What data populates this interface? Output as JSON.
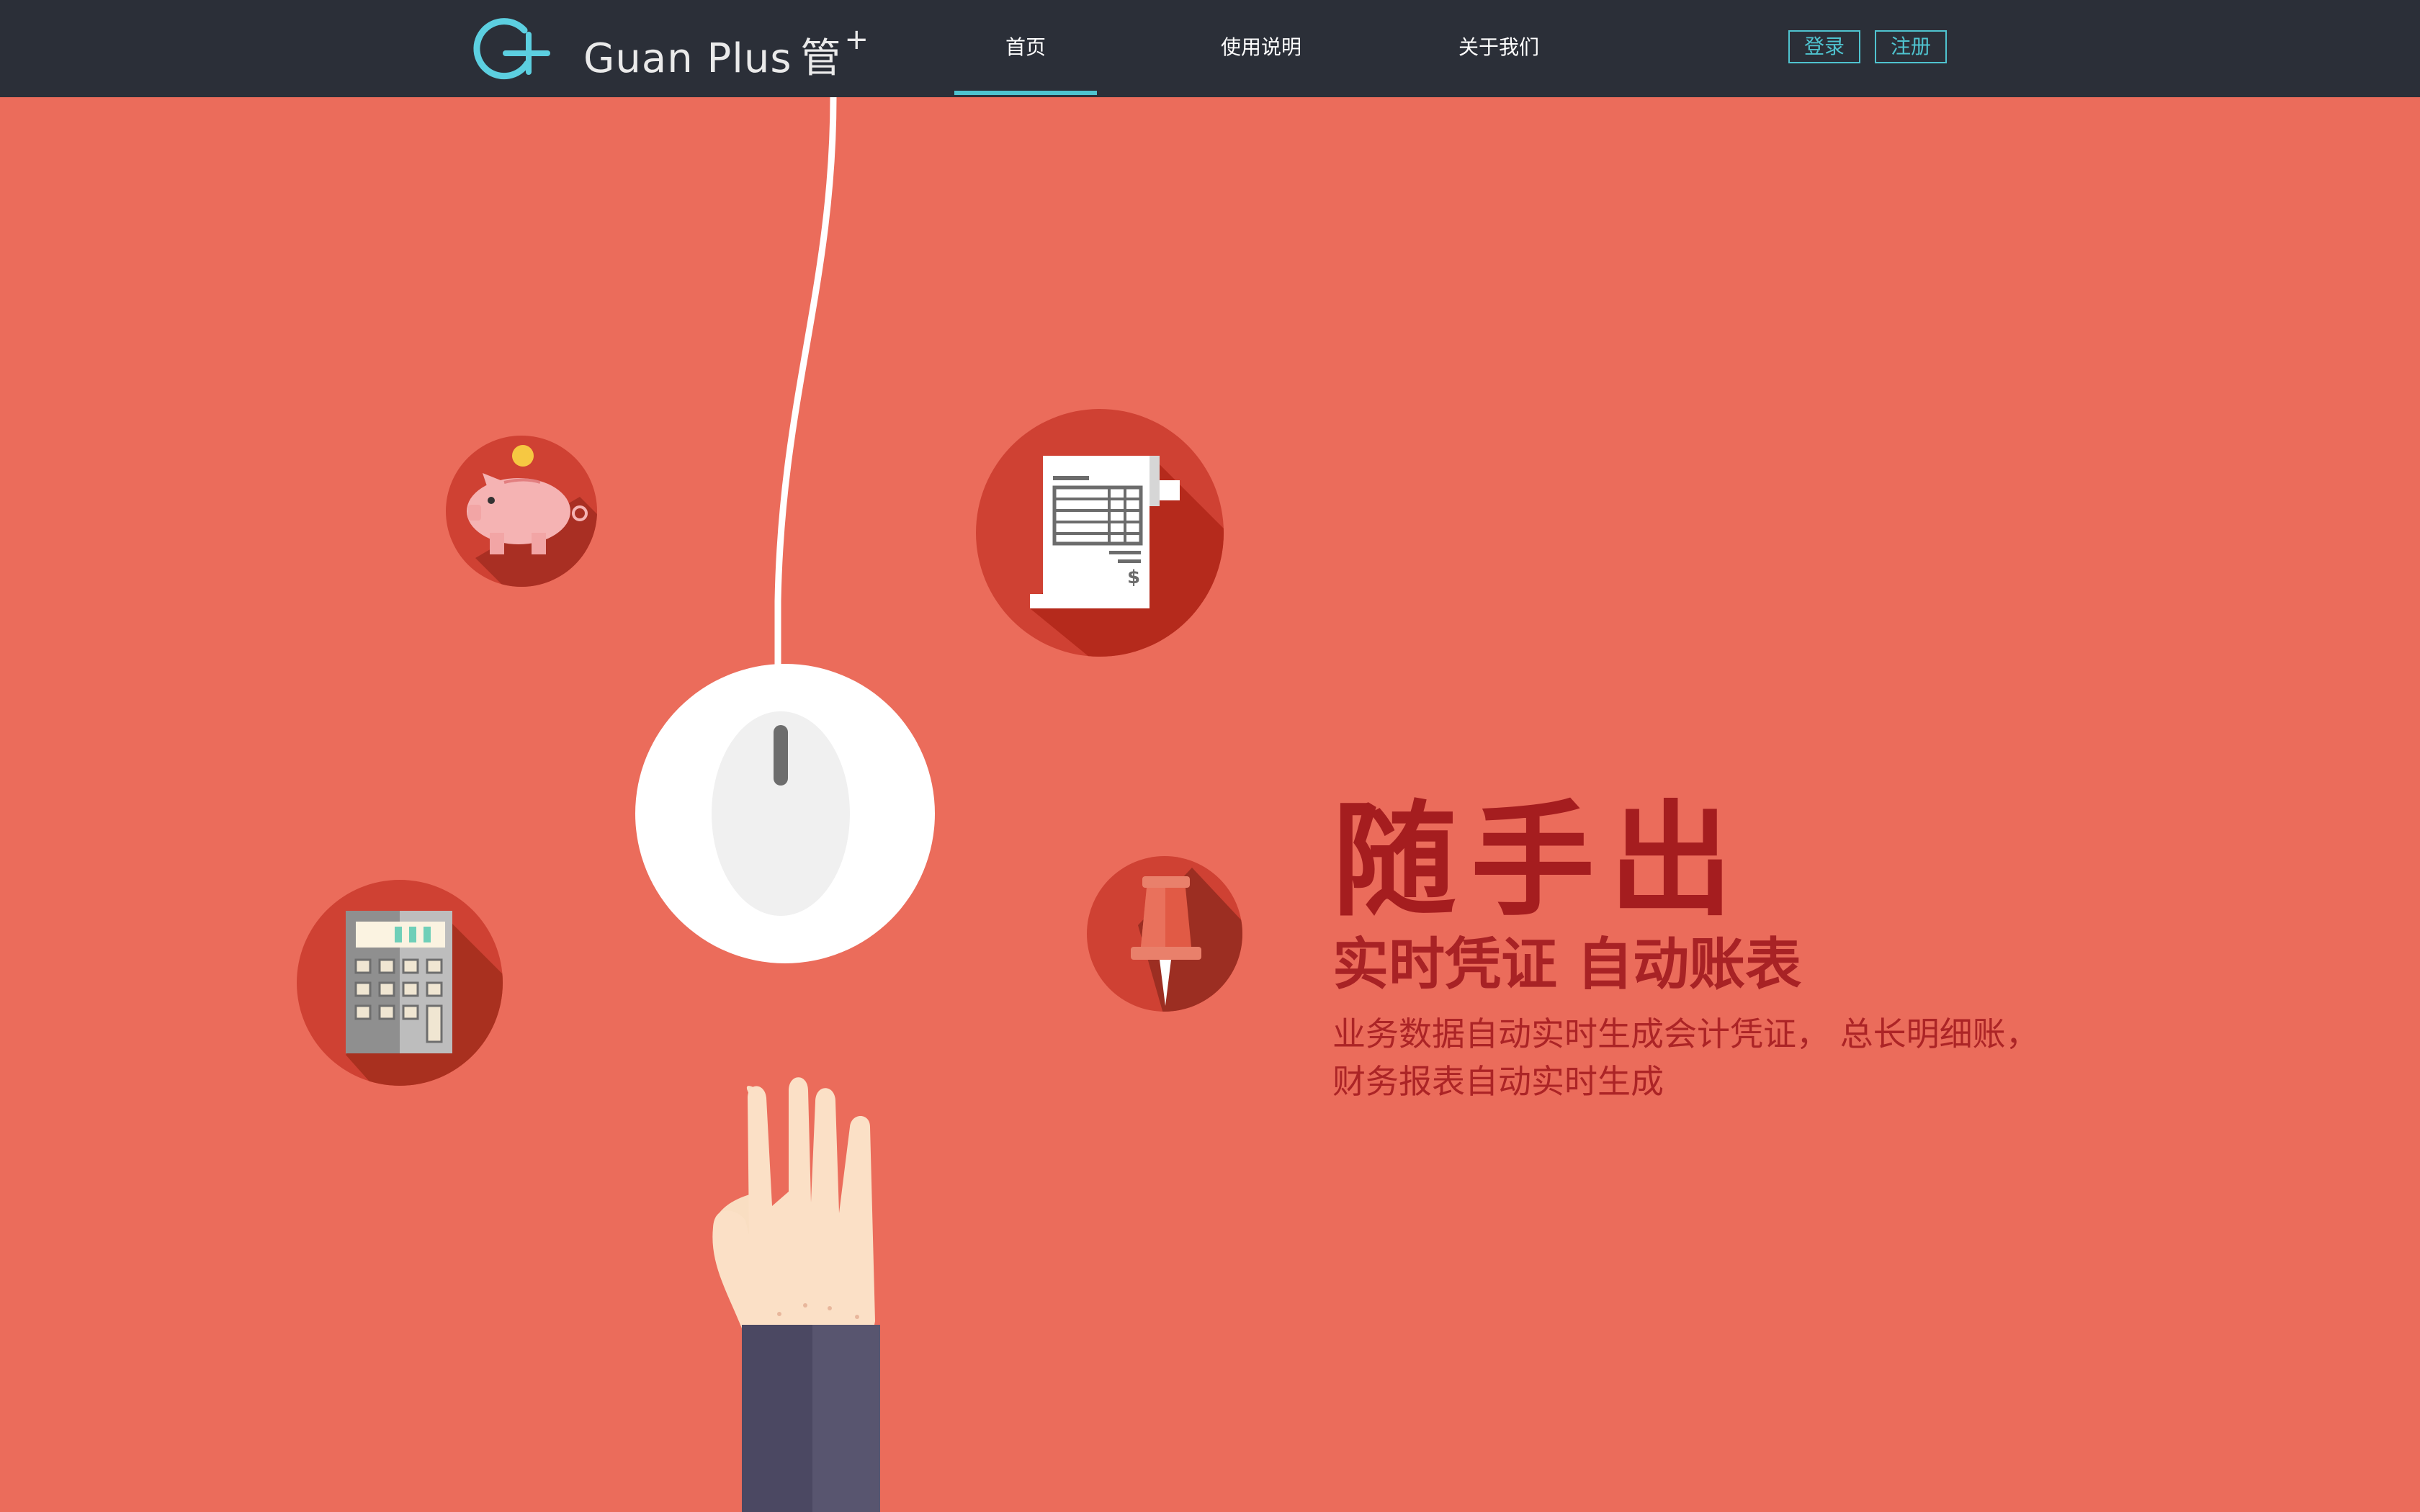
{
  "nav": {
    "brand": "Guan Plus",
    "brand_cn": "管",
    "brand_plus": "+",
    "tabs": [
      {
        "label": "首页",
        "active": true
      },
      {
        "label": "使用说明",
        "active": false
      },
      {
        "label": "关于我们",
        "active": false
      }
    ],
    "login_label": "登录",
    "register_label": "注册"
  },
  "hero": {
    "headline": "随手出",
    "subheadline": "实时凭证 自动账表",
    "desc_line1": "业务数据自动实时生成会计凭证， 总长明细账，",
    "desc_line2": "财务报表自动实时生成"
  },
  "icons": [
    "piggy-bank-icon",
    "receipt-icon",
    "calculator-icon",
    "pushpin-icon",
    "mouse-icon",
    "hand-icon"
  ],
  "colors": {
    "background": "#eb6c5b",
    "navbar": "#2b2f38",
    "accent": "#4fc3cf",
    "headline": "#a51d1f",
    "icon_circle": "#cf4133"
  }
}
